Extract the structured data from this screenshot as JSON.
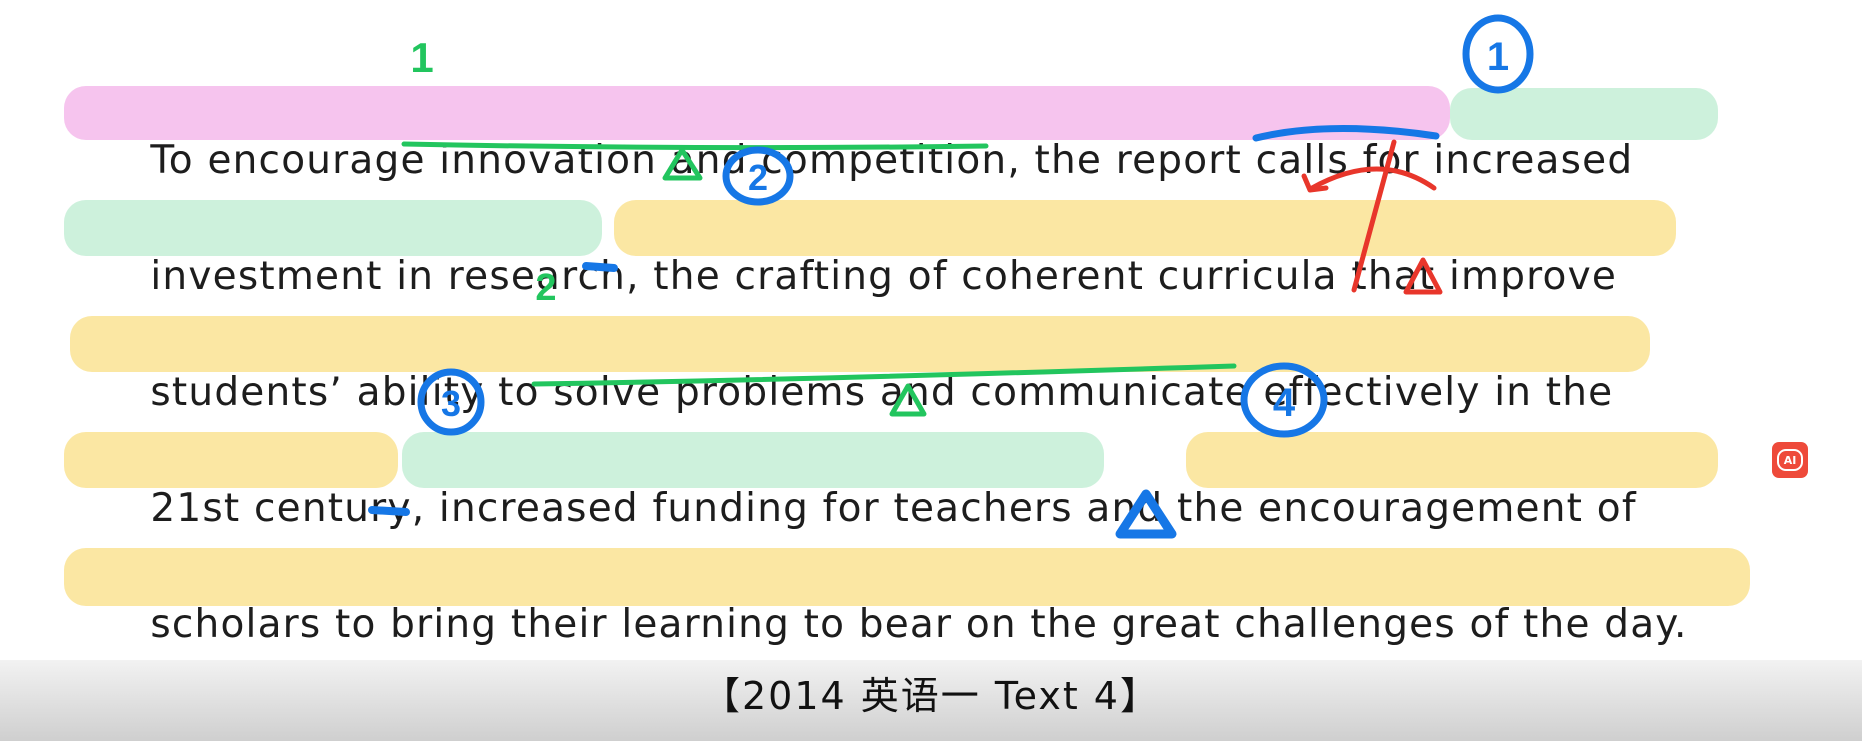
{
  "passage": {
    "line1": {
      "a": "To encourage ",
      "b": "innovation and competition",
      "c": ", the report ",
      "d": "calls for",
      "e": " increased"
    },
    "line2": {
      "a": "investment in research",
      "b": ", ",
      "c": "the crafting of coherent curricula",
      "d": " that improve"
    },
    "line3": {
      "a": "students’ ability to ",
      "b": "solve problems and communicate",
      "c": " effectively in the"
    },
    "line4": {
      "a": "21st century",
      "b": ", ",
      "c": "increased funding for teachers",
      "d": " and ",
      "e": "the encouragement of"
    },
    "line5": {
      "a": "scholars to bring their learning to bear on the great challenges of the day."
    }
  },
  "annotations": {
    "mark1": "1",
    "mark2": "2",
    "circle1": "1",
    "circle2": "2",
    "circle3": "3",
    "circle4": "4"
  },
  "source": "【2014 英语一 Text 4】",
  "badge": "AI",
  "colors": {
    "pink_highlight": "#f6c4ee",
    "green_highlight": "#cdf1dc",
    "yellow_highlight": "#fbe7a3",
    "green_ink": "#22c55e",
    "blue_ink": "#1677e6",
    "red_ink": "#e8362b",
    "badge": "#ee4a3a"
  }
}
